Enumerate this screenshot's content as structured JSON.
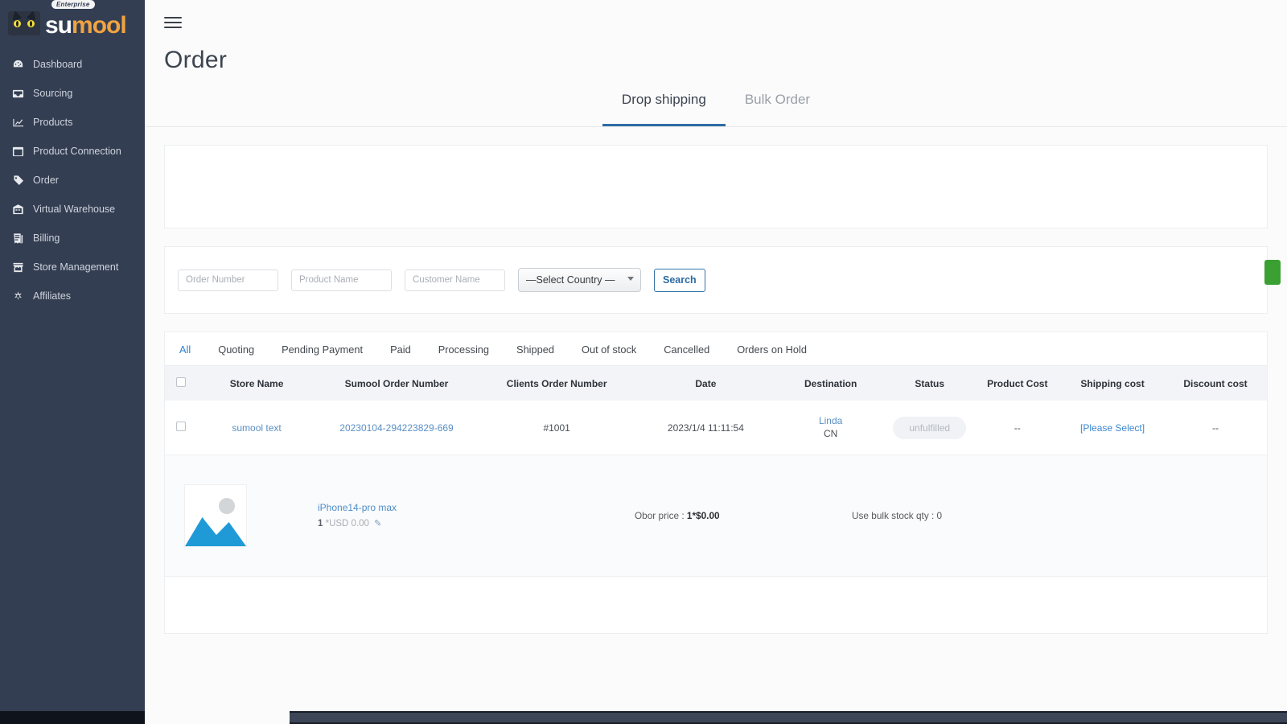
{
  "brand": {
    "bubble": "Enterprise",
    "name_part1": "su",
    "name_part2": "mool",
    "logo_icon": "cat-face-icon"
  },
  "sidebar": {
    "items": [
      {
        "label": "Dashboard",
        "icon": "dashboard-icon"
      },
      {
        "label": "Sourcing",
        "icon": "inbox-icon"
      },
      {
        "label": "Products",
        "icon": "chart-line-icon"
      },
      {
        "label": "Product Connection",
        "icon": "window-icon"
      },
      {
        "label": "Order",
        "icon": "tag-icon"
      },
      {
        "label": "Virtual Warehouse",
        "icon": "warehouse-icon"
      },
      {
        "label": "Billing",
        "icon": "invoice-icon"
      },
      {
        "label": "Store Management",
        "icon": "store-icon"
      },
      {
        "label": "Affiliates",
        "icon": "sparkle-icon"
      }
    ]
  },
  "header": {
    "menu_toggle": "hamburger-icon",
    "title": "Order"
  },
  "tabs": [
    {
      "label": "Drop shipping",
      "active": true
    },
    {
      "label": "Bulk Order",
      "active": false
    }
  ],
  "filters": {
    "order_number": {
      "placeholder": "Order Number",
      "value": ""
    },
    "product_name": {
      "placeholder": "Product Name",
      "value": ""
    },
    "customer_name": {
      "placeholder": "Customer Name",
      "value": ""
    },
    "country": {
      "selected": "—Select Country —",
      "options": [
        "—Select Country —"
      ]
    },
    "search_button": "Search",
    "side_action_color": "#3aa032"
  },
  "status_tabs": [
    {
      "label": "All",
      "active": true
    },
    {
      "label": "Quoting",
      "active": false
    },
    {
      "label": "Pending Payment",
      "active": false
    },
    {
      "label": "Paid",
      "active": false
    },
    {
      "label": "Processing",
      "active": false
    },
    {
      "label": "Shipped",
      "active": false
    },
    {
      "label": "Out of stock",
      "active": false
    },
    {
      "label": "Cancelled",
      "active": false
    },
    {
      "label": "Orders on Hold",
      "active": false
    }
  ],
  "table": {
    "headers": [
      "Store Name",
      "Sumool Order Number",
      "Clients Order Number",
      "Date",
      "Destination",
      "Status",
      "Product Cost",
      "Shipping cost",
      "Discount cost"
    ],
    "rows": [
      {
        "store_name": "sumool text",
        "sumool_order_number": "20230104-294223829-669",
        "clients_order_number": "#1001",
        "date": "2023/1/4 11:11:54",
        "destination_name": "Linda",
        "destination_country": "CN",
        "status": "unfulfilled",
        "product_cost": "--",
        "shipping_cost": "[Please Select]",
        "discount_cost": "--"
      }
    ],
    "product_line": {
      "thumb_icon": "image-placeholder-icon",
      "name": "iPhone14-pro max",
      "qty_price": "1 *USD 0.00",
      "qty": "1",
      "price_text": "*USD 0.00",
      "edit_icon": "pencil-icon",
      "obor_price_label": "Obor price : ",
      "obor_price_value": "1*$0.00",
      "bulk_stock_text": "Use bulk stock qty : 0"
    }
  },
  "colors": {
    "sidebar_bg": "#333e52",
    "accent_blue": "#2f6ba5",
    "link_blue": "#5a8fc4",
    "brand_orange": "#f0a342",
    "green_action": "#3aa032"
  }
}
